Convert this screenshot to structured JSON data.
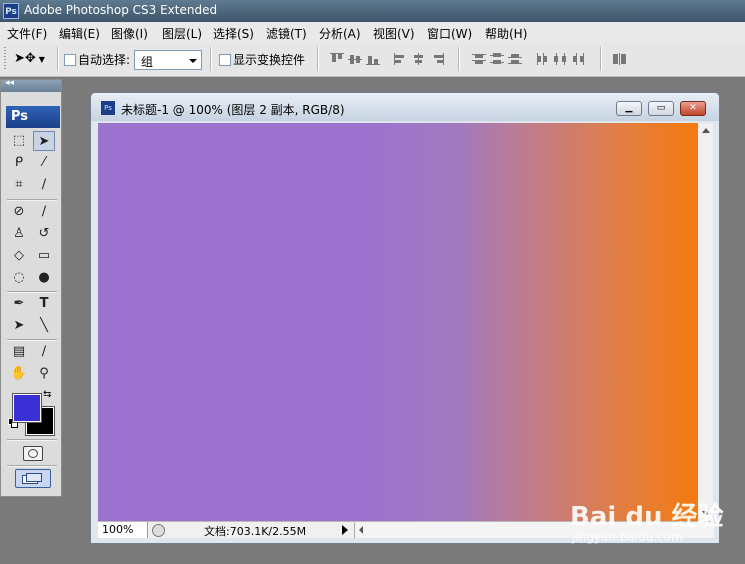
{
  "app": {
    "icon_text": "Ps",
    "title": "Adobe Photoshop CS3 Extended"
  },
  "menu": {
    "items": [
      "文件(F)",
      "编辑(E)",
      "图像(I)",
      "图层(L)",
      "选择(S)",
      "滤镜(T)",
      "分析(A)",
      "视图(V)",
      "窗口(W)",
      "帮助(H)"
    ]
  },
  "options_bar": {
    "auto_select_label": "自动选择:",
    "auto_select_value": "组",
    "show_transform_label": "显示变换控件"
  },
  "toolbox": {
    "collapse_glyph": "◂◂",
    "logo_text": "Ps",
    "foreground_color": "#3b2fd6",
    "background_color": "#000000"
  },
  "document": {
    "icon_text": "Ps",
    "title": "未标题-1 @ 100% (图层 2 副本, RGB/8)",
    "zoom": "100%",
    "doc_info": "文档:703.1K/2.55M",
    "gradient_colors": [
      "#9c73cf",
      "#f47a10"
    ]
  },
  "watermark": {
    "brand": "Bai du 经验",
    "site": "jingyan.baidu.com"
  }
}
